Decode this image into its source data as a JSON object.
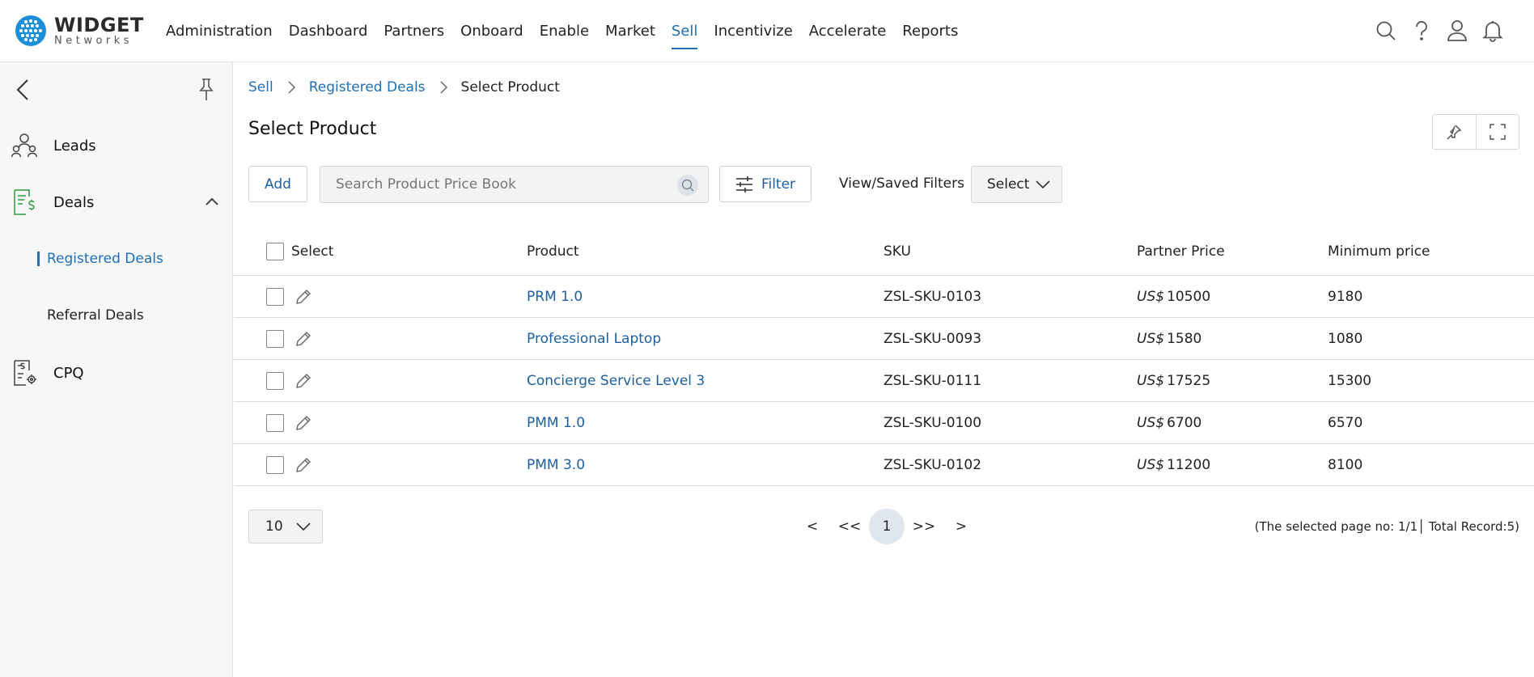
{
  "header": {
    "logo_title": "WIDGET",
    "logo_subtitle": "Networks",
    "nav": [
      {
        "label": "Administration",
        "active": false
      },
      {
        "label": "Dashboard",
        "active": false
      },
      {
        "label": "Partners",
        "active": false
      },
      {
        "label": "Onboard",
        "active": false
      },
      {
        "label": "Enable",
        "active": false
      },
      {
        "label": "Market",
        "active": false
      },
      {
        "label": "Sell",
        "active": true
      },
      {
        "label": "Incentivize",
        "active": false
      },
      {
        "label": "Accelerate",
        "active": false
      },
      {
        "label": "Reports",
        "active": false
      }
    ],
    "icons": [
      "search-icon",
      "help-icon",
      "user-icon",
      "bell-icon"
    ],
    "accent_color": "#1d6fb8"
  },
  "sidebar": {
    "items": [
      {
        "label": "Leads",
        "icon": "leads-icon"
      },
      {
        "label": "Deals",
        "icon": "deals-icon",
        "expanded": true
      },
      {
        "label": "CPQ",
        "icon": "cpq-icon"
      }
    ],
    "sub_items": [
      {
        "label": "Registered Deals",
        "active": true
      },
      {
        "label": "Referral Deals",
        "active": false
      }
    ]
  },
  "breadcrumb": {
    "items": [
      "Sell",
      "Registered Deals"
    ],
    "current": "Select Product"
  },
  "page": {
    "title": "Select Product"
  },
  "toolbar": {
    "add_label": "Add",
    "search_placeholder": "Search Product Price Book",
    "filter_label": "Filter",
    "saved_filters_label": "View/Saved Filters",
    "saved_filters_value": "Select"
  },
  "table": {
    "headers": {
      "select": "Select",
      "product": "Product",
      "sku": "SKU",
      "partner_price": "Partner Price",
      "minimum_price": "Minimum price"
    },
    "rows": [
      {
        "product": "PRM 1.0",
        "sku": "ZSL-SKU-0103",
        "currency": "US$",
        "partner_price": "10500",
        "minimum_price": "9180"
      },
      {
        "product": "Professional Laptop",
        "sku": "ZSL-SKU-0093",
        "currency": "US$",
        "partner_price": "1580",
        "minimum_price": "1080"
      },
      {
        "product": "Concierge Service Level 3",
        "sku": "ZSL-SKU-0111",
        "currency": "US$",
        "partner_price": "17525",
        "minimum_price": "15300"
      },
      {
        "product": "PMM 1.0",
        "sku": "ZSL-SKU-0100",
        "currency": "US$",
        "partner_price": "6700",
        "minimum_price": "6570"
      },
      {
        "product": "PMM 3.0",
        "sku": "ZSL-SKU-0102",
        "currency": "US$",
        "partner_price": "11200",
        "minimum_price": "8100"
      }
    ]
  },
  "pagination": {
    "page_size": "10",
    "prev": "<",
    "first": "<<",
    "current_page": "1",
    "last": ">>",
    "next": ">",
    "info": "(The selected page no: 1/1│ Total Record:5)"
  }
}
